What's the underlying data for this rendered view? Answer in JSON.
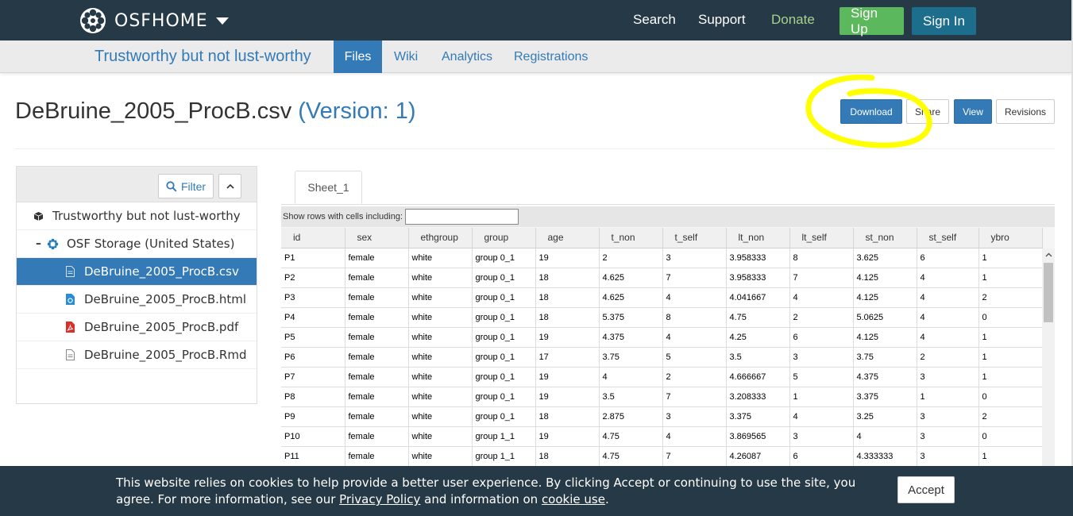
{
  "nav": {
    "brand": "OSFHOME",
    "links": {
      "search": "Search",
      "support": "Support",
      "donate": "Donate"
    },
    "signup": "Sign Up",
    "signin": "Sign In"
  },
  "project": {
    "title": "Trustworthy but not lust-worthy",
    "tabs": {
      "files": "Files",
      "wiki": "Wiki",
      "analytics": "Analytics",
      "registrations": "Registrations"
    }
  },
  "file": {
    "name": "DeBruine_2005_ProcB.csv",
    "version": "(Version: 1)",
    "actions": {
      "download": "Download",
      "share": "Share",
      "view": "View",
      "revisions": "Revisions"
    }
  },
  "tree": {
    "filter_label": "Filter",
    "project": "Trustworthy but not lust-worthy",
    "storage": "OSF Storage (United States)",
    "files": [
      "DeBruine_2005_ProcB.csv",
      "DeBruine_2005_ProcB.html",
      "DeBruine_2005_ProcB.pdf",
      "DeBruine_2005_ProcB.Rmd"
    ]
  },
  "sheet": {
    "tab": "Sheet_1",
    "filter_label": "Show rows with cells including:",
    "filter_value": "",
    "columns": [
      "id",
      "sex",
      "ethgroup",
      "group",
      "age",
      "t_non",
      "t_self",
      "lt_non",
      "lt_self",
      "st_non",
      "st_self",
      "ybro"
    ],
    "rows": [
      [
        "P1",
        "female",
        "white",
        "group 0_1",
        "19",
        "2",
        "3",
        "3.958333",
        "8",
        "3.625",
        "6",
        "1"
      ],
      [
        "P2",
        "female",
        "white",
        "group 0_1",
        "18",
        "4.625",
        "7",
        "3.958333",
        "7",
        "4.125",
        "4",
        "1"
      ],
      [
        "P3",
        "female",
        "white",
        "group 0_1",
        "18",
        "4.625",
        "4",
        "4.041667",
        "4",
        "4.125",
        "4",
        "2"
      ],
      [
        "P4",
        "female",
        "white",
        "group 0_1",
        "18",
        "5.375",
        "8",
        "4.75",
        "2",
        "5.0625",
        "4",
        "0"
      ],
      [
        "P5",
        "female",
        "white",
        "group 0_1",
        "19",
        "4.375",
        "4",
        "4.25",
        "6",
        "4.125",
        "4",
        "1"
      ],
      [
        "P6",
        "female",
        "white",
        "group 0_1",
        "17",
        "3.75",
        "5",
        "3.5",
        "3",
        "3.75",
        "2",
        "1"
      ],
      [
        "P7",
        "female",
        "white",
        "group 0_1",
        "19",
        "4",
        "2",
        "4.666667",
        "5",
        "4.375",
        "3",
        "1"
      ],
      [
        "P8",
        "female",
        "white",
        "group 0_1",
        "19",
        "3.5",
        "7",
        "3.208333",
        "1",
        "3.375",
        "1",
        "0"
      ],
      [
        "P9",
        "female",
        "white",
        "group 0_1",
        "18",
        "2.875",
        "3",
        "3.375",
        "4",
        "3.25",
        "3",
        "2"
      ],
      [
        "P10",
        "female",
        "white",
        "group 1_1",
        "19",
        "4.75",
        "4",
        "3.869565",
        "3",
        "4",
        "3",
        "0"
      ],
      [
        "P11",
        "female",
        "white",
        "group 1_1",
        "18",
        "4.75",
        "7",
        "4.26087",
        "6",
        "4.333333",
        "3",
        "1"
      ]
    ]
  },
  "cookie": {
    "text_1": "This website relies on cookies to help provide a better user experience. By clicking Accept or continuing to use the site, you agree. For more information, see our ",
    "privacy_link": "Privacy Policy",
    "text_2": " and information on ",
    "cookie_link": "cookie use",
    "text_3": ".",
    "accept": "Accept"
  },
  "colors": {
    "navbar": "#263947",
    "primary": "#337ab7",
    "signup": "#5cb85c",
    "signin": "#1c6e8c",
    "donate": "#a8d18a",
    "highlight": "#ffff00"
  },
  "icons": {
    "logo": "osf-logo-icon",
    "caret": "caret-down-icon",
    "filter": "magnifier-icon",
    "collapse": "chevron-up-icon",
    "project": "cube-icon",
    "storage": "osf-storage-icon",
    "csv": "file-text-icon",
    "html": "file-html-icon",
    "pdf": "file-pdf-icon",
    "rmd": "file-text-icon"
  }
}
